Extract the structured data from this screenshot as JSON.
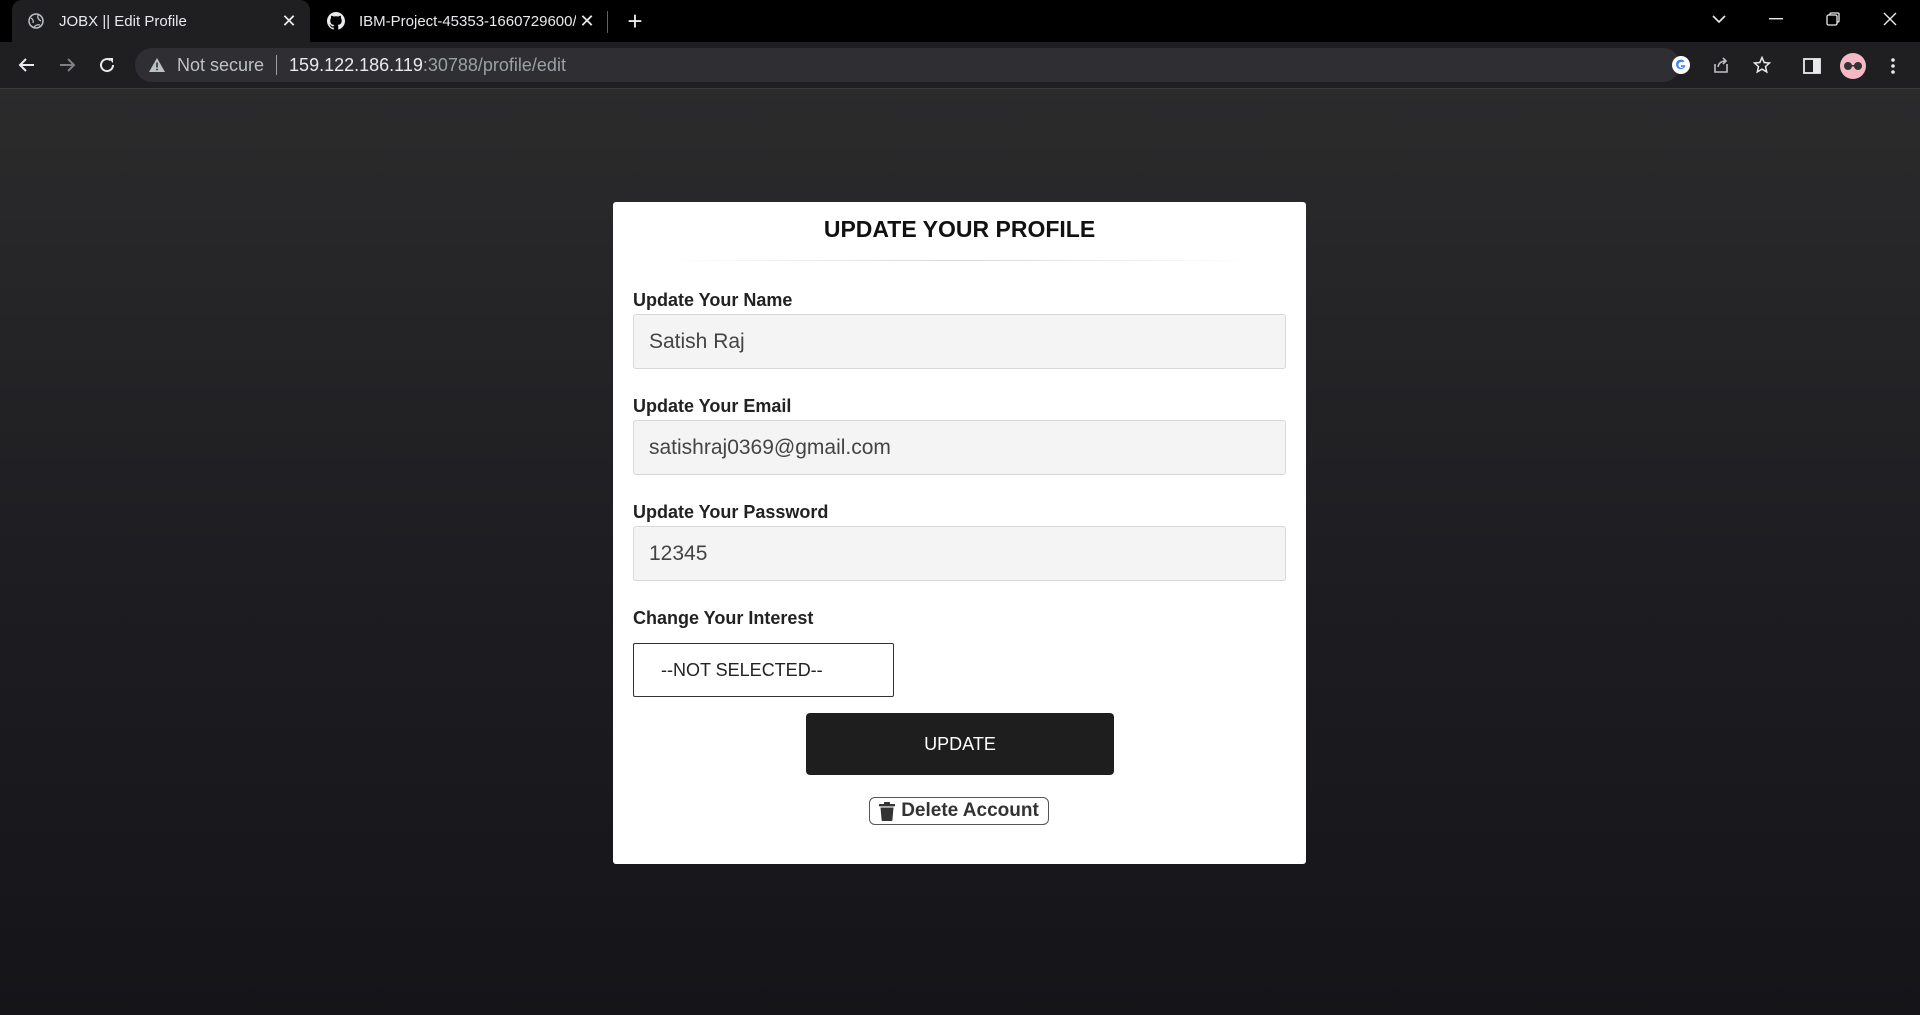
{
  "browser": {
    "tabs": [
      {
        "title": "JOBX || Edit Profile",
        "icon": "globe-icon",
        "active": true
      },
      {
        "title": "IBM-Project-45353-1660729600/",
        "icon": "github-icon",
        "active": false
      }
    ],
    "url": {
      "security_text": "Not secure",
      "host": "159.122.186.119",
      "path": ":30788/profile/edit"
    }
  },
  "form": {
    "title": "UPDATE YOUR PROFILE",
    "name_label": "Update Your Name",
    "name_value": "Satish Raj",
    "email_label": "Update Your Email",
    "email_value": "satishraj0369@gmail.com",
    "password_label": "Update Your Password",
    "password_value": "12345",
    "interest_label": "Change Your Interest",
    "interest_selected": "--NOT SELECTED--",
    "update_label": "UPDATE",
    "delete_label": "Delete Account"
  },
  "colors": {
    "page_background": "#1c1c1f",
    "button_dark": "#1e1e1e",
    "card": "#ffffff"
  }
}
